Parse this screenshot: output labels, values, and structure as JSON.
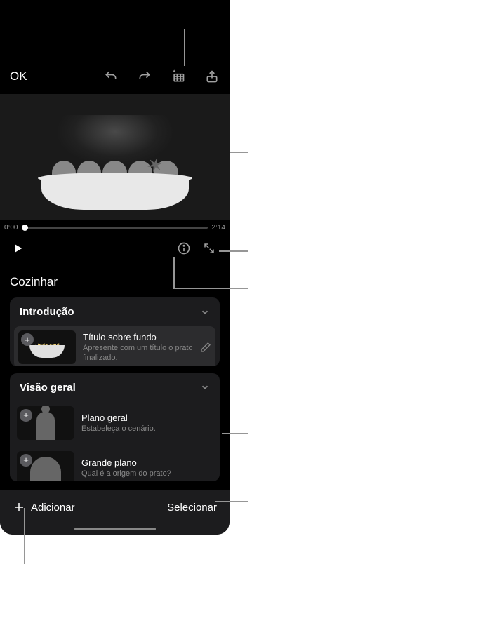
{
  "toolbar": {
    "ok_label": "OK"
  },
  "timeline": {
    "start_time": "0:00",
    "end_time": "2:14"
  },
  "project": {
    "title": "Cozinhar"
  },
  "sections": [
    {
      "title": "Introdução",
      "clips": [
        {
          "thumb_label": "Título aqui",
          "title": "Título sobre fundo",
          "description": "Apresente com um título o prato finalizado."
        }
      ]
    },
    {
      "title": "Visão geral",
      "clips": [
        {
          "title": "Plano geral",
          "description": "Estabeleça o cenário."
        },
        {
          "title": "Grande plano",
          "description": "Qual é a origem do prato?"
        }
      ]
    }
  ],
  "bottom_bar": {
    "add_label": "Adicionar",
    "select_label": "Selecionar"
  }
}
